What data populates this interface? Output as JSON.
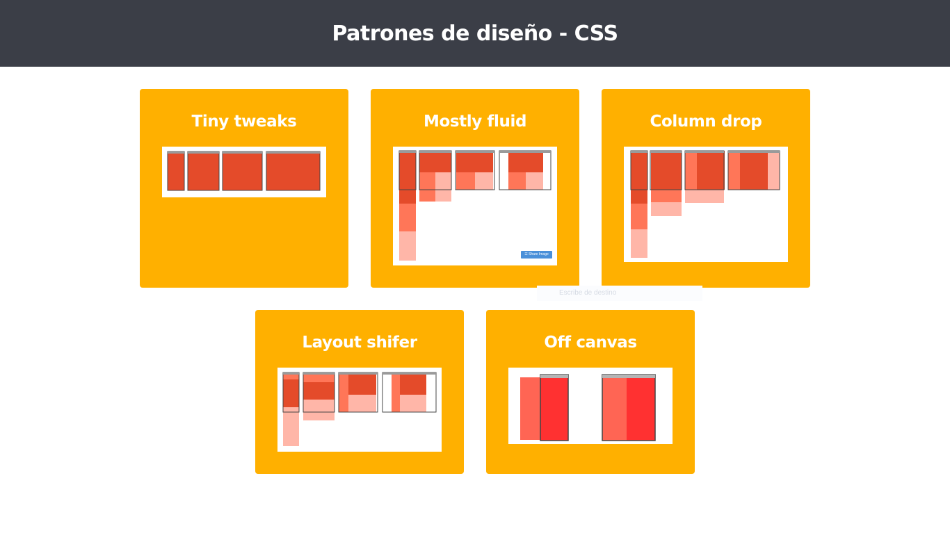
{
  "header": {
    "title": "Patrones de diseño - CSS"
  },
  "cards": [
    {
      "title": "Tiny tweaks"
    },
    {
      "title": "Mostly fluid",
      "share_button": "☰ Share Image"
    },
    {
      "title": "Column drop"
    },
    {
      "title": "Layout shifer"
    },
    {
      "title": "Off canvas"
    }
  ],
  "ghost_tooltip": "Escribe de destino",
  "colors": {
    "header_bg": "#3b3e47",
    "card_bg": "#ffb000",
    "red_dark": "#e44b2a",
    "red_mid": "#ff7658",
    "red_light": "#ffb6a8",
    "red_bright": "#ff3131"
  }
}
